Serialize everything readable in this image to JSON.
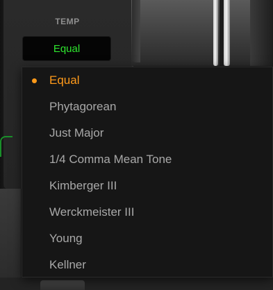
{
  "temp": {
    "label": "TEMP",
    "value": "Equal"
  },
  "menu": {
    "selected_index": 0,
    "items": [
      {
        "label": "Equal"
      },
      {
        "label": "Phytagorean"
      },
      {
        "label": "Just Major"
      },
      {
        "label": "1/4 Comma Mean Tone"
      },
      {
        "label": "Kimberger III"
      },
      {
        "label": "Werckmeister III"
      },
      {
        "label": "Young"
      },
      {
        "label": "Kellner"
      }
    ]
  },
  "colors": {
    "selected_text": "#ff9a1a",
    "normal_text": "#a9a9a9",
    "display_text": "#2ee62e",
    "menu_background": "#161616"
  }
}
